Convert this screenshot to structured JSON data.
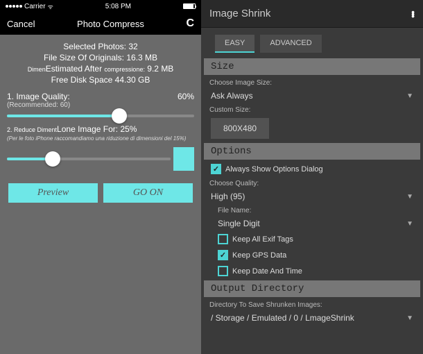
{
  "left": {
    "status": {
      "carrier": "Carrier",
      "wifi": "ᯤ",
      "time": "5:08 PM"
    },
    "nav": {
      "cancel": "Cancel",
      "title": "Photo Compress",
      "action": "C"
    },
    "info": {
      "selected": "Selected Photos: 32",
      "filesize_label": "File Size Of Originals:",
      "filesize_val": "16.3 MB",
      "estimated_prefix": "Dimen",
      "estimated_mid": "Estimated After",
      "estimated_suffix": "compressione:",
      "estimated_val": "9.2 MB",
      "freespace_label": "Free Disk Space",
      "freespace_val": "44.30 GB"
    },
    "quality": {
      "title": "1. Image Quality:",
      "value": "60%",
      "recommended": "(Recommended: 60)",
      "slider_pct": 60
    },
    "dimension": {
      "prefix": "2. Reduce Diment",
      "mid": "Lone Image For:",
      "value": "25%",
      "note": "(Per le foto iPhone raccomandiamo una riduzione di dimensioni del 15%)",
      "slider_pct": 28
    },
    "buttons": {
      "preview": "Preview",
      "goon": "GO ON"
    }
  },
  "right": {
    "title": "Image Shrink",
    "tabs": {
      "easy": "EASY",
      "advanced": "ADVANCED"
    },
    "sections": {
      "size": "Size",
      "options": "Options",
      "output": "Output Directory"
    },
    "size": {
      "choose_label": "Choose Image Size:",
      "choose_value": "Ask Always",
      "custom_label": "Custom Size:",
      "custom_value": "800X480"
    },
    "options": {
      "always_show": "Always Show Options Dialog",
      "quality_label": "Choose Quality:",
      "quality_value": "High (95)",
      "filename_label": "File Name:",
      "filename_value": "Single Digit",
      "keep_exif": "Keep All Exif Tags",
      "keep_gps": "Keep GPS Data",
      "keep_date": "Keep Date And Time"
    },
    "output": {
      "dir_label": "Directory To Save Shrunken Images:",
      "dir_value": "/ Storage / Emulated / 0 / LmageShrink"
    }
  }
}
